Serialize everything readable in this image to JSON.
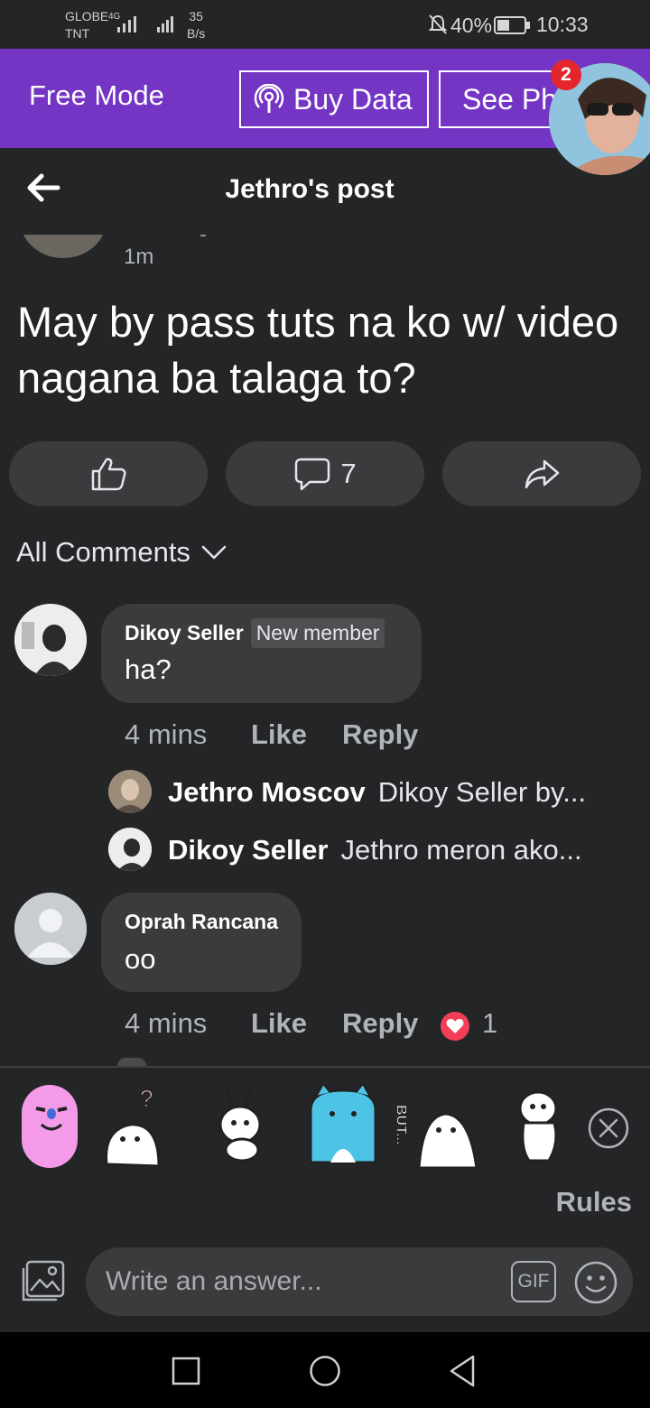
{
  "status_bar": {
    "carrier_top": "GLOBE",
    "carrier_bottom": "TNT",
    "network_type": "4G",
    "speed_value": "35",
    "speed_unit": "B/s",
    "battery": "40%",
    "time": "10:33"
  },
  "banner": {
    "free_mode": "Free Mode",
    "buy_data": "Buy Data",
    "see_photos": "See Ph",
    "chat_badge_count": "2"
  },
  "header": {
    "title": "Jethro's post"
  },
  "post": {
    "time": "1m",
    "text": "May by pass tuts na ko w/ video nagana ba talaga to?",
    "comment_count": "7"
  },
  "comments_filter": "All Comments",
  "comments": [
    {
      "name": "Dikoy Seller",
      "tag": "New member",
      "text": "ha?",
      "time": "4 mins",
      "like": "Like",
      "reply": "Reply",
      "replies": [
        {
          "name": "Jethro Moscov",
          "preview": "Dikoy Seller by..."
        },
        {
          "name": "Dikoy Seller",
          "preview": "Jethro meron ako..."
        }
      ]
    },
    {
      "name": "Oprah Rancana",
      "text": "oo",
      "time": "4 mins",
      "like": "Like",
      "reply": "Reply",
      "reaction_count": "1"
    }
  ],
  "composer": {
    "rules": "Rules",
    "placeholder": "Write an answer...",
    "gif": "GIF",
    "sticker_text": "BUT..."
  },
  "colors": {
    "banner": "#7434c4",
    "background": "#242526",
    "pill": "#3a3b3c",
    "badge": "#e4262c"
  }
}
